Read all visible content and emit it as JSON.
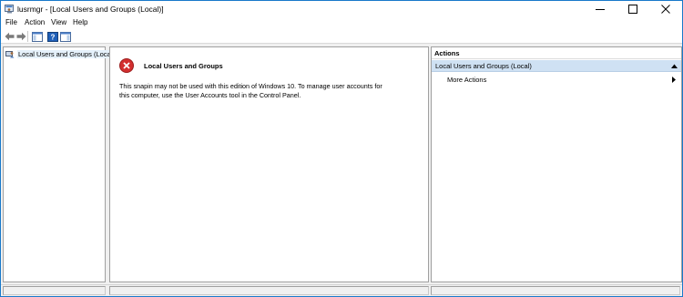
{
  "window": {
    "title": "lusrmgr - [Local Users and Groups (Local)]",
    "accent": "#1979ca"
  },
  "menu": {
    "file": "File",
    "action": "Action",
    "view": "View",
    "help": "Help"
  },
  "toolbar": {
    "icons": [
      "back-arrow-icon",
      "forward-arrow-icon",
      "show-hide-console-tree-icon",
      "help-icon",
      "show-hide-action-pane-icon"
    ]
  },
  "tree": {
    "root_label": "Local Users and Groups (Local)"
  },
  "center": {
    "error_title": "Local Users and Groups",
    "error_message": "This snapin may not be used with this edition of Windows 10. To manage user accounts for this computer, use the User Accounts tool in the Control Panel."
  },
  "actions": {
    "header": "Actions",
    "group_label": "Local Users and Groups (Local)",
    "more_actions": "More Actions"
  }
}
